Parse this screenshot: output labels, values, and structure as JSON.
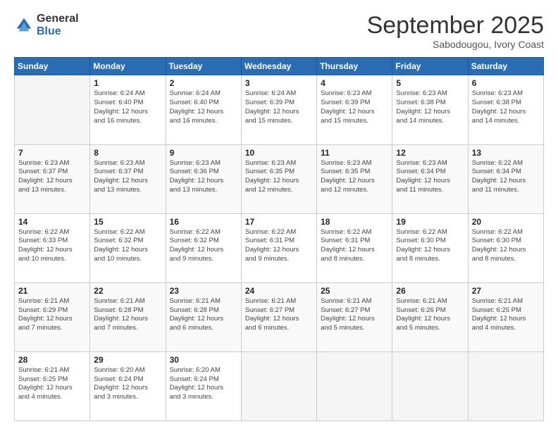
{
  "logo": {
    "general": "General",
    "blue": "Blue"
  },
  "header": {
    "month": "September 2025",
    "location": "Sabodougou, Ivory Coast"
  },
  "days_of_week": [
    "Sunday",
    "Monday",
    "Tuesday",
    "Wednesday",
    "Thursday",
    "Friday",
    "Saturday"
  ],
  "weeks": [
    [
      {
        "day": "",
        "info": ""
      },
      {
        "day": "1",
        "info": "Sunrise: 6:24 AM\nSunset: 6:40 PM\nDaylight: 12 hours\nand 16 minutes."
      },
      {
        "day": "2",
        "info": "Sunrise: 6:24 AM\nSunset: 6:40 PM\nDaylight: 12 hours\nand 16 minutes."
      },
      {
        "day": "3",
        "info": "Sunrise: 6:24 AM\nSunset: 6:39 PM\nDaylight: 12 hours\nand 15 minutes."
      },
      {
        "day": "4",
        "info": "Sunrise: 6:23 AM\nSunset: 6:39 PM\nDaylight: 12 hours\nand 15 minutes."
      },
      {
        "day": "5",
        "info": "Sunrise: 6:23 AM\nSunset: 6:38 PM\nDaylight: 12 hours\nand 14 minutes."
      },
      {
        "day": "6",
        "info": "Sunrise: 6:23 AM\nSunset: 6:38 PM\nDaylight: 12 hours\nand 14 minutes."
      }
    ],
    [
      {
        "day": "7",
        "info": "Sunrise: 6:23 AM\nSunset: 6:37 PM\nDaylight: 12 hours\nand 13 minutes."
      },
      {
        "day": "8",
        "info": "Sunrise: 6:23 AM\nSunset: 6:37 PM\nDaylight: 12 hours\nand 13 minutes."
      },
      {
        "day": "9",
        "info": "Sunrise: 6:23 AM\nSunset: 6:36 PM\nDaylight: 12 hours\nand 13 minutes."
      },
      {
        "day": "10",
        "info": "Sunrise: 6:23 AM\nSunset: 6:35 PM\nDaylight: 12 hours\nand 12 minutes."
      },
      {
        "day": "11",
        "info": "Sunrise: 6:23 AM\nSunset: 6:35 PM\nDaylight: 12 hours\nand 12 minutes."
      },
      {
        "day": "12",
        "info": "Sunrise: 6:23 AM\nSunset: 6:34 PM\nDaylight: 12 hours\nand 11 minutes."
      },
      {
        "day": "13",
        "info": "Sunrise: 6:22 AM\nSunset: 6:34 PM\nDaylight: 12 hours\nand 11 minutes."
      }
    ],
    [
      {
        "day": "14",
        "info": "Sunrise: 6:22 AM\nSunset: 6:33 PM\nDaylight: 12 hours\nand 10 minutes."
      },
      {
        "day": "15",
        "info": "Sunrise: 6:22 AM\nSunset: 6:32 PM\nDaylight: 12 hours\nand 10 minutes."
      },
      {
        "day": "16",
        "info": "Sunrise: 6:22 AM\nSunset: 6:32 PM\nDaylight: 12 hours\nand 9 minutes."
      },
      {
        "day": "17",
        "info": "Sunrise: 6:22 AM\nSunset: 6:31 PM\nDaylight: 12 hours\nand 9 minutes."
      },
      {
        "day": "18",
        "info": "Sunrise: 6:22 AM\nSunset: 6:31 PM\nDaylight: 12 hours\nand 8 minutes."
      },
      {
        "day": "19",
        "info": "Sunrise: 6:22 AM\nSunset: 6:30 PM\nDaylight: 12 hours\nand 8 minutes."
      },
      {
        "day": "20",
        "info": "Sunrise: 6:22 AM\nSunset: 6:30 PM\nDaylight: 12 hours\nand 8 minutes."
      }
    ],
    [
      {
        "day": "21",
        "info": "Sunrise: 6:21 AM\nSunset: 6:29 PM\nDaylight: 12 hours\nand 7 minutes."
      },
      {
        "day": "22",
        "info": "Sunrise: 6:21 AM\nSunset: 6:28 PM\nDaylight: 12 hours\nand 7 minutes."
      },
      {
        "day": "23",
        "info": "Sunrise: 6:21 AM\nSunset: 6:28 PM\nDaylight: 12 hours\nand 6 minutes."
      },
      {
        "day": "24",
        "info": "Sunrise: 6:21 AM\nSunset: 6:27 PM\nDaylight: 12 hours\nand 6 minutes."
      },
      {
        "day": "25",
        "info": "Sunrise: 6:21 AM\nSunset: 6:27 PM\nDaylight: 12 hours\nand 5 minutes."
      },
      {
        "day": "26",
        "info": "Sunrise: 6:21 AM\nSunset: 6:26 PM\nDaylight: 12 hours\nand 5 minutes."
      },
      {
        "day": "27",
        "info": "Sunrise: 6:21 AM\nSunset: 6:25 PM\nDaylight: 12 hours\nand 4 minutes."
      }
    ],
    [
      {
        "day": "28",
        "info": "Sunrise: 6:21 AM\nSunset: 6:25 PM\nDaylight: 12 hours\nand 4 minutes."
      },
      {
        "day": "29",
        "info": "Sunrise: 6:20 AM\nSunset: 6:24 PM\nDaylight: 12 hours\nand 3 minutes."
      },
      {
        "day": "30",
        "info": "Sunrise: 6:20 AM\nSunset: 6:24 PM\nDaylight: 12 hours\nand 3 minutes."
      },
      {
        "day": "",
        "info": ""
      },
      {
        "day": "",
        "info": ""
      },
      {
        "day": "",
        "info": ""
      },
      {
        "day": "",
        "info": ""
      }
    ]
  ]
}
